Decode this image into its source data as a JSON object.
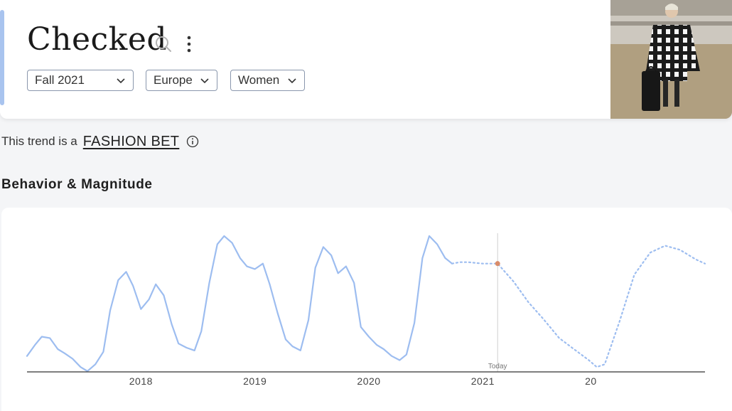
{
  "header": {
    "title": "Checked",
    "filters": [
      {
        "label": "Fall 2021"
      },
      {
        "label": "Europe"
      },
      {
        "label": "Women"
      }
    ],
    "icons": {
      "search": "search-icon",
      "more": "more-vertical-icon",
      "chevron": "chevron-down-icon"
    },
    "accent_color": "#a9c4ef"
  },
  "trend": {
    "prefix": "This trend is a",
    "label": "FASHION BET",
    "info_icon": "info-icon"
  },
  "section": {
    "title": "Behavior & Magnitude"
  },
  "chart_data": {
    "type": "line",
    "x_tick_labels": [
      "2018",
      "2019",
      "2020",
      "2021",
      "20"
    ],
    "today_label": "Today",
    "today_x": 2021.13,
    "line_color": "#9dbdf0",
    "marker_color": "#d98c6a",
    "grid": false,
    "series": [
      {
        "style": "solid",
        "points": [
          [
            2017.0,
            0.11
          ],
          [
            2017.07,
            0.19
          ],
          [
            2017.13,
            0.25
          ],
          [
            2017.2,
            0.24
          ],
          [
            2017.27,
            0.16
          ],
          [
            2017.33,
            0.13
          ],
          [
            2017.4,
            0.09
          ],
          [
            2017.47,
            0.03
          ],
          [
            2017.53,
            0.0
          ],
          [
            2017.6,
            0.05
          ],
          [
            2017.67,
            0.14
          ],
          [
            2017.73,
            0.44
          ],
          [
            2017.8,
            0.66
          ],
          [
            2017.87,
            0.72
          ],
          [
            2017.93,
            0.62
          ],
          [
            2018.0,
            0.45
          ],
          [
            2018.07,
            0.52
          ],
          [
            2018.13,
            0.63
          ],
          [
            2018.2,
            0.55
          ],
          [
            2018.27,
            0.34
          ],
          [
            2018.33,
            0.2
          ],
          [
            2018.4,
            0.17
          ],
          [
            2018.47,
            0.15
          ],
          [
            2018.53,
            0.29
          ],
          [
            2018.6,
            0.64
          ],
          [
            2018.67,
            0.92
          ],
          [
            2018.73,
            0.98
          ],
          [
            2018.8,
            0.93
          ],
          [
            2018.87,
            0.82
          ],
          [
            2018.93,
            0.76
          ],
          [
            2019.0,
            0.74
          ],
          [
            2019.07,
            0.78
          ],
          [
            2019.13,
            0.63
          ],
          [
            2019.2,
            0.42
          ],
          [
            2019.27,
            0.23
          ],
          [
            2019.33,
            0.18
          ],
          [
            2019.4,
            0.15
          ],
          [
            2019.47,
            0.37
          ],
          [
            2019.53,
            0.75
          ],
          [
            2019.6,
            0.9
          ],
          [
            2019.67,
            0.84
          ],
          [
            2019.73,
            0.71
          ],
          [
            2019.8,
            0.76
          ],
          [
            2019.87,
            0.64
          ],
          [
            2019.93,
            0.32
          ],
          [
            2020.0,
            0.25
          ],
          [
            2020.07,
            0.19
          ],
          [
            2020.13,
            0.16
          ],
          [
            2020.2,
            0.11
          ],
          [
            2020.27,
            0.08
          ],
          [
            2020.33,
            0.12
          ],
          [
            2020.4,
            0.35
          ],
          [
            2020.47,
            0.82
          ],
          [
            2020.53,
            0.98
          ],
          [
            2020.6,
            0.92
          ],
          [
            2020.67,
            0.82
          ],
          [
            2020.73,
            0.78
          ]
        ]
      },
      {
        "style": "dashed",
        "points": [
          [
            2020.73,
            0.78
          ],
          [
            2020.8,
            0.79
          ],
          [
            2020.87,
            0.79
          ],
          [
            2021.0,
            0.78
          ],
          [
            2021.13,
            0.78
          ],
          [
            2021.27,
            0.65
          ],
          [
            2021.4,
            0.5
          ],
          [
            2021.53,
            0.38
          ],
          [
            2021.67,
            0.24
          ],
          [
            2021.8,
            0.16
          ],
          [
            2021.93,
            0.08
          ],
          [
            2022.0,
            0.03
          ],
          [
            2022.07,
            0.05
          ],
          [
            2022.2,
            0.36
          ],
          [
            2022.33,
            0.7
          ],
          [
            2022.47,
            0.86
          ],
          [
            2022.6,
            0.91
          ],
          [
            2022.73,
            0.88
          ],
          [
            2022.87,
            0.81
          ],
          [
            2022.95,
            0.78
          ]
        ]
      }
    ]
  }
}
